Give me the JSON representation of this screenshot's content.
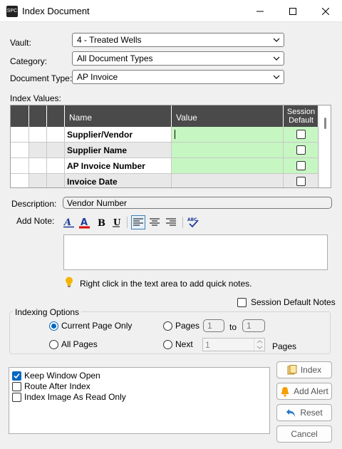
{
  "window": {
    "title": "Index Document",
    "icon_text": "SPC"
  },
  "form": {
    "vault_label": "Vault:",
    "vault_value": "4 - Treated Wells",
    "category_label": "Category:",
    "category_value": "All Document Types",
    "doctype_label": "Document Type:",
    "doctype_value": "AP Invoice"
  },
  "index_values": {
    "label": "Index Values:",
    "columns": {
      "name": "Name",
      "value": "Value",
      "session_default_1": "Session",
      "session_default_2": "Default"
    },
    "rows": [
      {
        "name": "Supplier/Vendor",
        "value": "",
        "session_default": false
      },
      {
        "name": "Supplier Name",
        "value": "",
        "session_default": false
      },
      {
        "name": "AP Invoice Number",
        "value": "",
        "session_default": false
      },
      {
        "name": "Invoice Date",
        "value": "",
        "session_default": false
      }
    ]
  },
  "description": {
    "label": "Description:",
    "value": "Vendor Number"
  },
  "note": {
    "label": "Add Note:",
    "hint": "Right click in the text area to add quick notes.",
    "session_default_notes": "Session Default Notes",
    "spellcheck_glyph": "ABC"
  },
  "indexing_options": {
    "title": "Indexing Options",
    "current_page_only": "Current Page Only",
    "all_pages": "All Pages",
    "pages_label": "Pages",
    "pages_from": "1",
    "pages_to_label": "to",
    "pages_to": "1",
    "next_label": "Next",
    "next_value": "1",
    "next_suffix": "Pages"
  },
  "options": {
    "keep_window_open": "Keep Window Open",
    "route_after_index": "Route After Index",
    "index_read_only": "Index Image As Read Only"
  },
  "buttons": {
    "index": "Index",
    "add_alert": "Add Alert",
    "reset": "Reset",
    "cancel": "Cancel"
  },
  "colors": {
    "accent": "#0067c0",
    "value_cell": "#c6f7c2",
    "header": "#4a4a4a",
    "alt_row": "#e8e8e8"
  }
}
